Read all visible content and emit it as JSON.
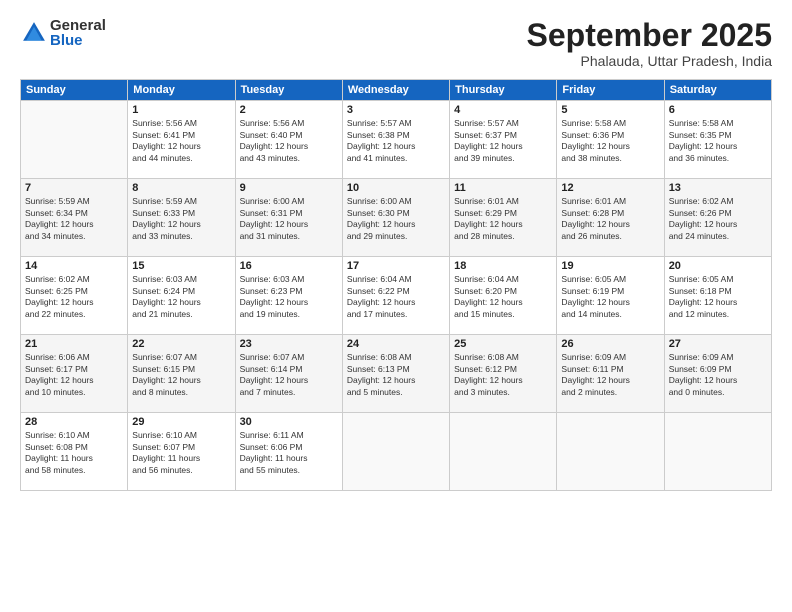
{
  "logo": {
    "general": "General",
    "blue": "Blue"
  },
  "title": "September 2025",
  "subtitle": "Phalauda, Uttar Pradesh, India",
  "headers": [
    "Sunday",
    "Monday",
    "Tuesday",
    "Wednesday",
    "Thursday",
    "Friday",
    "Saturday"
  ],
  "weeks": [
    [
      {
        "day": "",
        "info": ""
      },
      {
        "day": "1",
        "info": "Sunrise: 5:56 AM\nSunset: 6:41 PM\nDaylight: 12 hours\nand 44 minutes."
      },
      {
        "day": "2",
        "info": "Sunrise: 5:56 AM\nSunset: 6:40 PM\nDaylight: 12 hours\nand 43 minutes."
      },
      {
        "day": "3",
        "info": "Sunrise: 5:57 AM\nSunset: 6:38 PM\nDaylight: 12 hours\nand 41 minutes."
      },
      {
        "day": "4",
        "info": "Sunrise: 5:57 AM\nSunset: 6:37 PM\nDaylight: 12 hours\nand 39 minutes."
      },
      {
        "day": "5",
        "info": "Sunrise: 5:58 AM\nSunset: 6:36 PM\nDaylight: 12 hours\nand 38 minutes."
      },
      {
        "day": "6",
        "info": "Sunrise: 5:58 AM\nSunset: 6:35 PM\nDaylight: 12 hours\nand 36 minutes."
      }
    ],
    [
      {
        "day": "7",
        "info": "Sunrise: 5:59 AM\nSunset: 6:34 PM\nDaylight: 12 hours\nand 34 minutes."
      },
      {
        "day": "8",
        "info": "Sunrise: 5:59 AM\nSunset: 6:33 PM\nDaylight: 12 hours\nand 33 minutes."
      },
      {
        "day": "9",
        "info": "Sunrise: 6:00 AM\nSunset: 6:31 PM\nDaylight: 12 hours\nand 31 minutes."
      },
      {
        "day": "10",
        "info": "Sunrise: 6:00 AM\nSunset: 6:30 PM\nDaylight: 12 hours\nand 29 minutes."
      },
      {
        "day": "11",
        "info": "Sunrise: 6:01 AM\nSunset: 6:29 PM\nDaylight: 12 hours\nand 28 minutes."
      },
      {
        "day": "12",
        "info": "Sunrise: 6:01 AM\nSunset: 6:28 PM\nDaylight: 12 hours\nand 26 minutes."
      },
      {
        "day": "13",
        "info": "Sunrise: 6:02 AM\nSunset: 6:26 PM\nDaylight: 12 hours\nand 24 minutes."
      }
    ],
    [
      {
        "day": "14",
        "info": "Sunrise: 6:02 AM\nSunset: 6:25 PM\nDaylight: 12 hours\nand 22 minutes."
      },
      {
        "day": "15",
        "info": "Sunrise: 6:03 AM\nSunset: 6:24 PM\nDaylight: 12 hours\nand 21 minutes."
      },
      {
        "day": "16",
        "info": "Sunrise: 6:03 AM\nSunset: 6:23 PM\nDaylight: 12 hours\nand 19 minutes."
      },
      {
        "day": "17",
        "info": "Sunrise: 6:04 AM\nSunset: 6:22 PM\nDaylight: 12 hours\nand 17 minutes."
      },
      {
        "day": "18",
        "info": "Sunrise: 6:04 AM\nSunset: 6:20 PM\nDaylight: 12 hours\nand 15 minutes."
      },
      {
        "day": "19",
        "info": "Sunrise: 6:05 AM\nSunset: 6:19 PM\nDaylight: 12 hours\nand 14 minutes."
      },
      {
        "day": "20",
        "info": "Sunrise: 6:05 AM\nSunset: 6:18 PM\nDaylight: 12 hours\nand 12 minutes."
      }
    ],
    [
      {
        "day": "21",
        "info": "Sunrise: 6:06 AM\nSunset: 6:17 PM\nDaylight: 12 hours\nand 10 minutes."
      },
      {
        "day": "22",
        "info": "Sunrise: 6:07 AM\nSunset: 6:15 PM\nDaylight: 12 hours\nand 8 minutes."
      },
      {
        "day": "23",
        "info": "Sunrise: 6:07 AM\nSunset: 6:14 PM\nDaylight: 12 hours\nand 7 minutes."
      },
      {
        "day": "24",
        "info": "Sunrise: 6:08 AM\nSunset: 6:13 PM\nDaylight: 12 hours\nand 5 minutes."
      },
      {
        "day": "25",
        "info": "Sunrise: 6:08 AM\nSunset: 6:12 PM\nDaylight: 12 hours\nand 3 minutes."
      },
      {
        "day": "26",
        "info": "Sunrise: 6:09 AM\nSunset: 6:11 PM\nDaylight: 12 hours\nand 2 minutes."
      },
      {
        "day": "27",
        "info": "Sunrise: 6:09 AM\nSunset: 6:09 PM\nDaylight: 12 hours\nand 0 minutes."
      }
    ],
    [
      {
        "day": "28",
        "info": "Sunrise: 6:10 AM\nSunset: 6:08 PM\nDaylight: 11 hours\nand 58 minutes."
      },
      {
        "day": "29",
        "info": "Sunrise: 6:10 AM\nSunset: 6:07 PM\nDaylight: 11 hours\nand 56 minutes."
      },
      {
        "day": "30",
        "info": "Sunrise: 6:11 AM\nSunset: 6:06 PM\nDaylight: 11 hours\nand 55 minutes."
      },
      {
        "day": "",
        "info": ""
      },
      {
        "day": "",
        "info": ""
      },
      {
        "day": "",
        "info": ""
      },
      {
        "day": "",
        "info": ""
      }
    ]
  ]
}
